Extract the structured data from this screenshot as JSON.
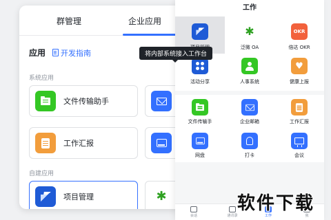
{
  "left": {
    "tabs": [
      {
        "label": "群管理"
      },
      {
        "label": "企业应用",
        "active": true
      }
    ],
    "header": {
      "title": "应用",
      "guide_link": "开发指南"
    },
    "sections": {
      "system": "系统应用",
      "custom": "自建应用"
    },
    "tooltip": "将内部系统接入工作台",
    "cards": [
      {
        "label": "文件传输助手",
        "icon": "file-transfer-icon",
        "color": "#34c724"
      },
      {
        "label": "",
        "icon": "mail-icon",
        "color": "#3370ff"
      },
      {
        "label": "工作汇报",
        "icon": "report-icon",
        "color": "#f29d3c"
      },
      {
        "label": "",
        "icon": "disk-icon",
        "color": "#3370ff"
      },
      {
        "label": "项目管理",
        "icon": "jira-icon",
        "color": "#1f5bd6",
        "selected": true
      },
      {
        "label": "",
        "icon": "flower-icon",
        "color": "#2ea121"
      }
    ]
  },
  "phone": {
    "title": "工作",
    "grid1": [
      {
        "label": "项目管理",
        "icon": "jira-icon",
        "color": "#1f5bd6",
        "highlight": true
      },
      {
        "label": "泛微 OA",
        "icon": "flower-icon",
        "color": "#2ea121"
      },
      {
        "label": "倍达 OKR",
        "icon": "okr-icon",
        "color": "#f2613c",
        "glyph": "OKR"
      },
      {
        "label": "活动分享",
        "icon": "activity-icon",
        "color": "#1f5bd6"
      },
      {
        "label": "人事系统",
        "icon": "hr-icon",
        "color": "#34c724"
      },
      {
        "label": "健康上报",
        "icon": "health-icon",
        "color": "#f29d3c"
      }
    ],
    "grid2": [
      {
        "label": "文件传输手",
        "icon": "file-transfer-icon",
        "color": "#34c724"
      },
      {
        "label": "企业邮箱",
        "icon": "mail-icon",
        "color": "#3370ff"
      },
      {
        "label": "工作汇报",
        "icon": "report-icon",
        "color": "#f29d3c"
      },
      {
        "label": "网盘",
        "icon": "disk-icon",
        "color": "#3370ff"
      },
      {
        "label": "打卡",
        "icon": "checkin-icon",
        "color": "#3370ff"
      },
      {
        "label": "会议",
        "icon": "meeting-icon",
        "color": "#3370ff"
      }
    ],
    "nav": [
      {
        "label": "会话",
        "icon": "chat-icon"
      },
      {
        "label": "通讯录",
        "icon": "contacts-icon"
      },
      {
        "label": "工作",
        "icon": "work-icon",
        "active": true
      },
      {
        "label": "我",
        "icon": "me-icon"
      }
    ]
  },
  "watermark": "软件下载",
  "colors": {
    "accent": "#3370ff",
    "tooltip_bg": "#1f2329"
  }
}
